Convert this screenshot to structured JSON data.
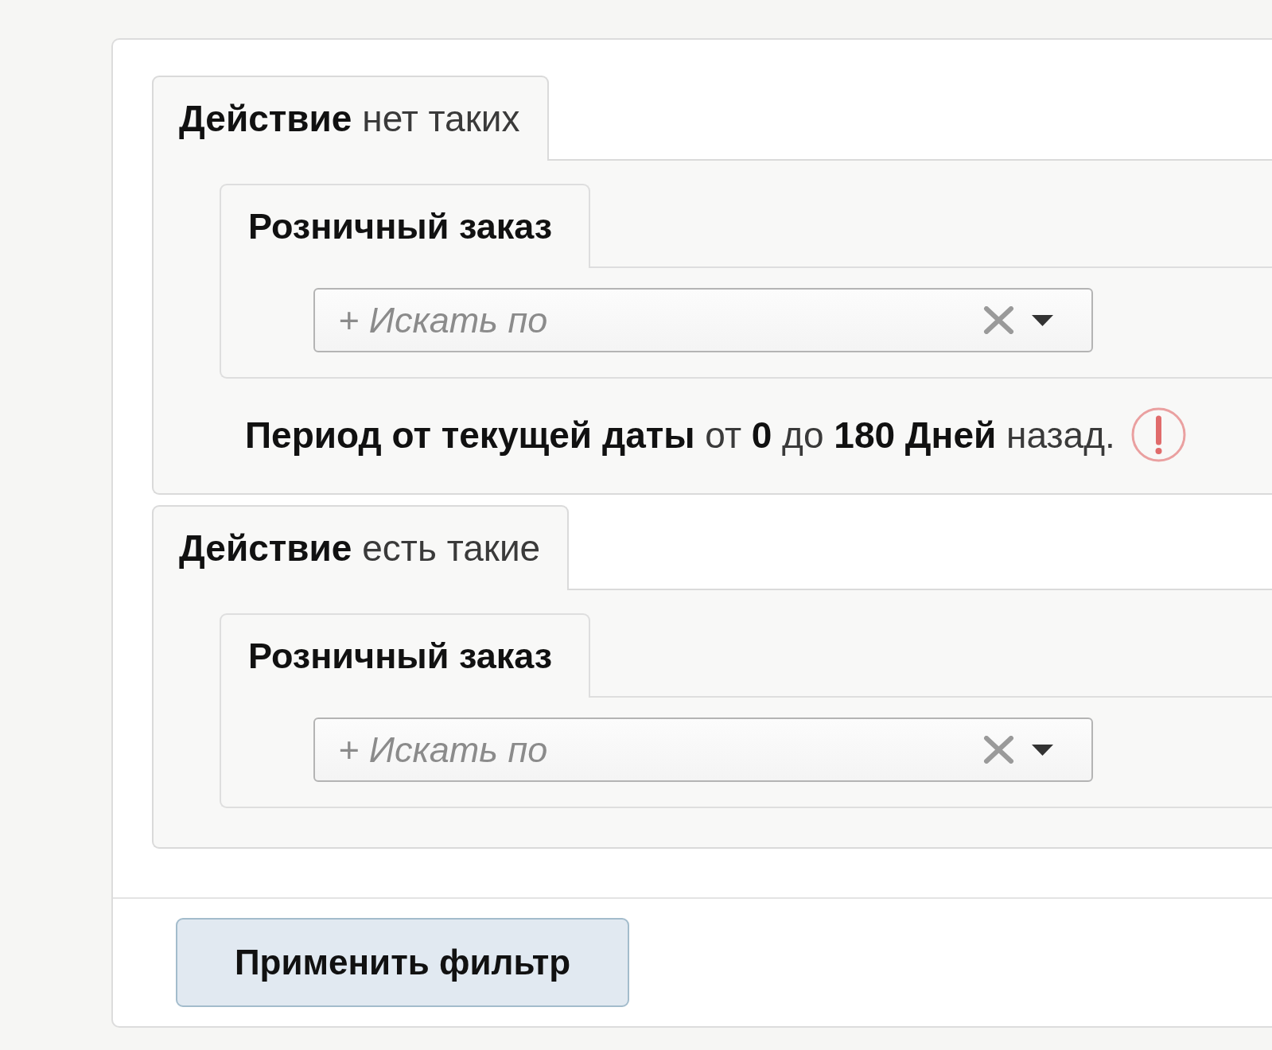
{
  "groups": [
    {
      "title": "**Действие** нет таких",
      "children": [
        {
          "title": "Розничный заказ",
          "search": {
            "placeholder": "+ Искать по"
          }
        }
      ],
      "period": {
        "text": "**Период от текущей даты** от **0** до **180 Дней** назад."
      }
    },
    {
      "title": "**Действие** есть такие",
      "children": [
        {
          "title": "Розничный заказ",
          "search": {
            "placeholder": "+ Искать по"
          }
        }
      ]
    }
  ],
  "button": {
    "label": "Применить фильтр"
  }
}
